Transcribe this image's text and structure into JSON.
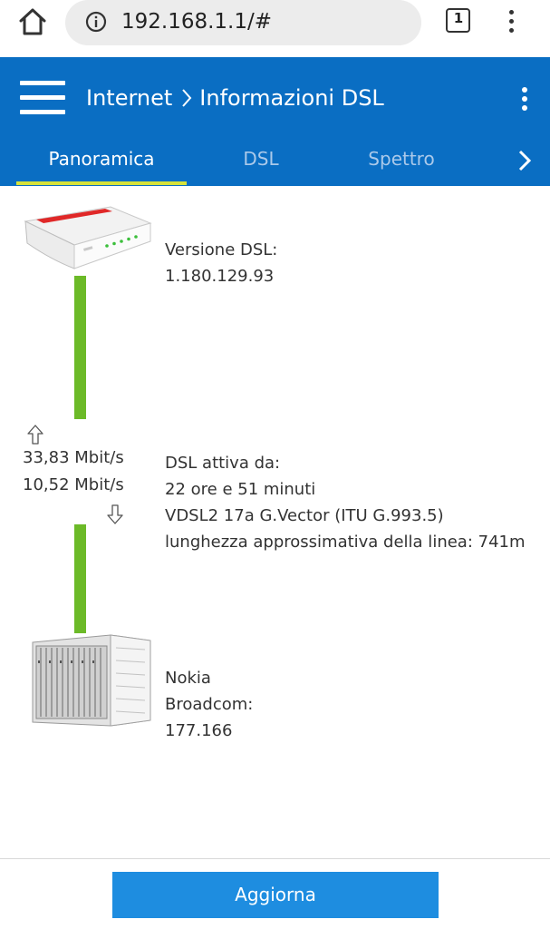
{
  "browser": {
    "url": "192.168.1.1/#",
    "tab_count": "1",
    "icons": [
      "home-icon",
      "info-icon",
      "tab-switcher-icon",
      "more-vertical-icon"
    ]
  },
  "header": {
    "breadcrumb_parent": "Internet",
    "breadcrumb_current": "Informazioni DSL",
    "background_color": "#0a6ec3",
    "tabs": [
      {
        "label": "Panoramica",
        "active": true
      },
      {
        "label": "DSL",
        "active": false
      },
      {
        "label": "Spettro",
        "active": false
      }
    ],
    "active_tab_indicator_color": "#d6e23a"
  },
  "overview": {
    "router": {
      "lines": [
        "Versione DSL:",
        "1.180.129.93"
      ]
    },
    "link": {
      "upstream": "33,83 Mbit/s",
      "downstream": "10,52 Mbit/s",
      "line_color": "#6cba28",
      "lines": [
        "DSL attiva da:",
        "22 ore e 51 minuti",
        "VDSL2 17a G.Vector (ITU G.993.5)",
        "lunghezza approssimativa della linea: 741m"
      ]
    },
    "dslam": {
      "lines": [
        "Nokia",
        "Broadcom:",
        "177.166"
      ]
    }
  },
  "footer": {
    "refresh_label": "Aggiorna",
    "button_color": "#1e8de0"
  }
}
